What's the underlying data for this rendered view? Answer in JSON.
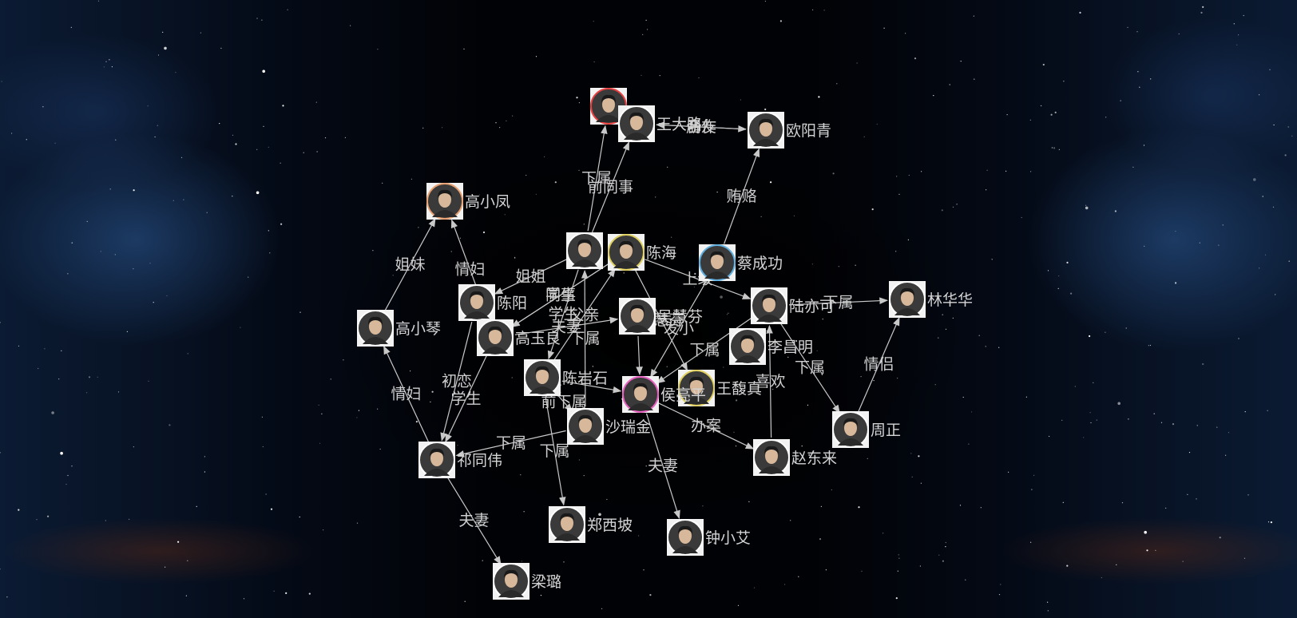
{
  "colors": {
    "label": "#d4d4d4",
    "edge": "#c8c8c8",
    "frame": "#f2f2f2"
  },
  "nodes": [
    {
      "id": "n1",
      "label": "高小凤",
      "ring": "#e8a070"
    },
    {
      "id": "n2",
      "label": "高小琴",
      "ring": "#ffffff"
    },
    {
      "id": "n3",
      "label": "陈阳",
      "ring": "#ffffff"
    },
    {
      "id": "n4",
      "label": "高玉良",
      "ring": "#ffffff"
    },
    {
      "id": "n5",
      "label": "陈岩石",
      "ring": "#ffffff"
    },
    {
      "id": "n6",
      "label": "",
      "ring": "#ffffff"
    },
    {
      "id": "n7",
      "label": "陈海",
      "ring": "#e0d060"
    },
    {
      "id": "n8",
      "label": "",
      "ring": "#e84040"
    },
    {
      "id": "n9",
      "label": "王大路",
      "ring": "#ffffff"
    },
    {
      "id": "n10",
      "label": "欧阳青",
      "ring": "#ffffff"
    },
    {
      "id": "n11",
      "label": "蔡成功",
      "ring": "#5fb0e0"
    },
    {
      "id": "n12",
      "label": "吴慧芬",
      "ring": "#ffffff"
    },
    {
      "id": "n13",
      "label": "陆亦可",
      "ring": "#ffffff"
    },
    {
      "id": "n14",
      "label": "李昌明",
      "ring": "#ffffff"
    },
    {
      "id": "n15",
      "label": "林华华",
      "ring": "#ffffff"
    },
    {
      "id": "n16",
      "label": "王馥真",
      "ring": "#e0d060"
    },
    {
      "id": "n17",
      "label": "侯亮平",
      "ring": "#e860c0"
    },
    {
      "id": "n18",
      "label": "沙瑞金",
      "ring": "#ffffff"
    },
    {
      "id": "n19",
      "label": "祁同伟",
      "ring": "#ffffff"
    },
    {
      "id": "n20",
      "label": "周正",
      "ring": "#ffffff"
    },
    {
      "id": "n21",
      "label": "赵东来",
      "ring": "#ffffff"
    },
    {
      "id": "n22",
      "label": "郑西坡",
      "ring": "#ffffff"
    },
    {
      "id": "n23",
      "label": "钟小艾",
      "ring": "#ffffff"
    },
    {
      "id": "n24",
      "label": "梁璐",
      "ring": "#ffffff"
    }
  ],
  "edges": [
    {
      "source": "n2",
      "target": "n1",
      "label": "姐妹"
    },
    {
      "source": "n4",
      "target": "n1",
      "label": "情妇"
    },
    {
      "source": "n19",
      "target": "n2",
      "label": "情妇"
    },
    {
      "source": "n4",
      "target": "n19",
      "label": "学生"
    },
    {
      "source": "n3",
      "target": "n19",
      "label": "初恋"
    },
    {
      "source": "n19",
      "target": "n24",
      "label": "夫妻"
    },
    {
      "source": "n5",
      "target": "n22",
      "label": "下属"
    },
    {
      "source": "n18",
      "target": "n19",
      "label": "下属"
    },
    {
      "source": "n5",
      "target": "n18",
      "label": "前下属"
    },
    {
      "source": "n6",
      "target": "n8",
      "label": "下属"
    },
    {
      "source": "n6",
      "target": "n9",
      "label": "前同事"
    },
    {
      "source": "n8",
      "target": "n9",
      "label": "丁义珍"
    },
    {
      "source": "n10",
      "target": "n9",
      "label": "合作"
    },
    {
      "source": "n9",
      "target": "n10",
      "label": "朋友"
    },
    {
      "source": "n11",
      "target": "n10",
      "label": "贿赂"
    },
    {
      "source": "n6",
      "target": "n3",
      "label": "姐姐"
    },
    {
      "source": "n7",
      "target": "n4",
      "label": "同事"
    },
    {
      "source": "n7",
      "target": "n4",
      "label": "学生"
    },
    {
      "source": "n4",
      "target": "n12",
      "label": "夫妻"
    },
    {
      "source": "n5",
      "target": "n7",
      "label": "父亲"
    },
    {
      "source": "n18",
      "target": "n6",
      "label": "下属"
    },
    {
      "source": "n6",
      "target": "n5",
      "label": "学生"
    },
    {
      "source": "n11",
      "target": "n17",
      "label": "发小"
    },
    {
      "source": "n7",
      "target": "n13",
      "label": "上级"
    },
    {
      "source": "n7",
      "target": "n16",
      "label": "吴慧芬"
    },
    {
      "source": "n13",
      "target": "n17",
      "label": "下属"
    },
    {
      "source": "n13",
      "target": "n15",
      "label": "下属"
    },
    {
      "source": "n13",
      "target": "n20",
      "label": "下属"
    },
    {
      "source": "n21",
      "target": "n13",
      "label": "喜欢"
    },
    {
      "source": "n20",
      "target": "n15",
      "label": "情侣"
    },
    {
      "source": "n17",
      "target": "n21",
      "label": "办案"
    },
    {
      "source": "n17",
      "target": "n23",
      "label": "夫妻"
    },
    {
      "source": "n5",
      "target": "n17",
      "label": ""
    },
    {
      "source": "n12",
      "target": "n17",
      "label": ""
    }
  ]
}
